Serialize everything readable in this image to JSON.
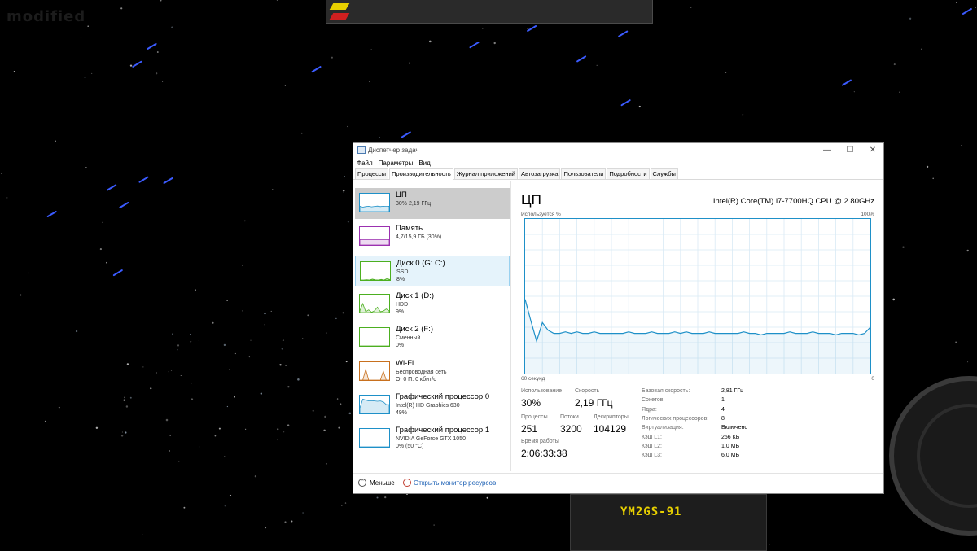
{
  "background": {
    "watermark": "modified",
    "ship_label": "YM2GS-91",
    "accent_colors": {
      "star": "#3b5bff",
      "hud_yellow": "#e8d000",
      "hud_red": "#d02020"
    }
  },
  "window": {
    "title": "Диспетчер задач",
    "controls": {
      "minimize": "—",
      "maximize": "☐",
      "close": "✕"
    },
    "menu": [
      "Файл",
      "Параметры",
      "Вид"
    ],
    "tabs": [
      "Процессы",
      "Производительность",
      "Журнал приложений",
      "Автозагрузка",
      "Пользователи",
      "Подробности",
      "Службы"
    ],
    "active_tab": "Производительность",
    "sidebar": [
      {
        "name": "ЦП",
        "sub1": "30%  2,19 ГГц",
        "sub2": "",
        "color": "#1e90c8",
        "state": "selected",
        "graph": [
          0.3,
          0.25,
          0.28,
          0.3,
          0.27,
          0.29,
          0.31,
          0.28,
          0.3,
          0.29,
          0.3
        ]
      },
      {
        "name": "Память",
        "sub1": "4,7/15,9 ГБ (30%)",
        "sub2": "",
        "color": "#9b30b0",
        "state": "",
        "graph": [
          0.3,
          0.3,
          0.3,
          0.3,
          0.3,
          0.3,
          0.3,
          0.3,
          0.3,
          0.3,
          0.3
        ]
      },
      {
        "name": "Диск 0 (G: C:)",
        "sub1": "SSD",
        "sub2": "8%",
        "color": "#4caf20",
        "state": "hover",
        "graph": [
          0,
          0,
          0.02,
          0,
          0.05,
          0.01,
          0,
          0.03,
          0,
          0.08,
          0.02
        ]
      },
      {
        "name": "Диск 1 (D:)",
        "sub1": "HDD",
        "sub2": "9%",
        "color": "#4caf20",
        "state": "",
        "graph": [
          0.1,
          0.5,
          0.05,
          0.15,
          0.02,
          0.1,
          0.3,
          0.05,
          0.08,
          0.2,
          0.09
        ]
      },
      {
        "name": "Диск 2 (F:)",
        "sub1": "Сменный",
        "sub2": "0%",
        "color": "#4caf20",
        "state": "",
        "graph": [
          0,
          0,
          0,
          0,
          0,
          0,
          0,
          0,
          0,
          0,
          0
        ]
      },
      {
        "name": "Wi-Fi",
        "sub1": "Беспроводная сеть",
        "sub2": "О: 0 П: 0 кбит/с",
        "color": "#c8701e",
        "state": "",
        "graph": [
          0,
          0,
          0.6,
          0,
          0,
          0,
          0,
          0,
          0.5,
          0,
          0
        ]
      },
      {
        "name": "Графический процессор 0",
        "sub1": "Intel(R) HD Graphics 630",
        "sub2": "49%",
        "color": "#1e90c8",
        "state": "",
        "graph": [
          0.3,
          0.8,
          0.75,
          0.7,
          0.72,
          0.7,
          0.68,
          0.7,
          0.65,
          0.5,
          0.49
        ]
      },
      {
        "name": "Графический процессор 1",
        "sub1": "NVIDIA GeForce GTX 1050",
        "sub2": "0% (50 °C)",
        "color": "#1e90c8",
        "state": "",
        "graph": [
          0,
          0,
          0,
          0,
          0,
          0,
          0,
          0,
          0,
          0,
          0
        ]
      }
    ],
    "main": {
      "title": "ЦП",
      "cpu_model": "Intel(R) Core(TM) i7-7700HQ CPU @ 2.80GHz",
      "y_label": "Используется %",
      "y_max_label": "100%",
      "x_left_label": "60 секунд",
      "x_right_label": "0",
      "chart_color": "#1e90c8",
      "stats": {
        "usage_label": "Использование",
        "usage": "30%",
        "speed_label": "Скорость",
        "speed": "2,19 ГГц",
        "procs_label": "Процессы",
        "procs": "251",
        "threads_label": "Потоки",
        "threads": "3200",
        "handles_label": "Дескрипторы",
        "handles": "104129",
        "uptime_label": "Время работы",
        "uptime": "2:06:33:38"
      },
      "details": [
        {
          "label": "Базовая скорость:",
          "value": "2,81 ГГц"
        },
        {
          "label": "Сокетов:",
          "value": "1"
        },
        {
          "label": "Ядра:",
          "value": "4"
        },
        {
          "label": "Логических процессоров:",
          "value": "8"
        },
        {
          "label": "Виртуализация:",
          "value": "Включено"
        },
        {
          "label": "Кэш L1:",
          "value": "256 КБ"
        },
        {
          "label": "Кэш L2:",
          "value": "1,0 МБ"
        },
        {
          "label": "Кэш L3:",
          "value": "6,0 МБ"
        }
      ]
    },
    "footer": {
      "less_label": "Меньше",
      "monitor_link": "Открыть монитор ресурсов"
    }
  },
  "chart_data": {
    "type": "area",
    "ylim": [
      0,
      100
    ],
    "x": [
      60,
      59,
      58,
      57,
      56,
      55,
      54,
      53,
      52,
      51,
      50,
      49,
      48,
      47,
      46,
      45,
      44,
      43,
      42,
      41,
      40,
      39,
      38,
      37,
      36,
      35,
      34,
      33,
      32,
      31,
      30,
      29,
      28,
      27,
      26,
      25,
      24,
      23,
      22,
      21,
      20,
      19,
      18,
      17,
      16,
      15,
      14,
      13,
      12,
      11,
      10,
      9,
      8,
      7,
      6,
      5,
      4,
      3,
      2,
      1,
      0
    ],
    "values": [
      48,
      34,
      21,
      33,
      28,
      26,
      26,
      27,
      26,
      27,
      26,
      26,
      27,
      26,
      26,
      26,
      26,
      26,
      27,
      26,
      26,
      26,
      27,
      26,
      26,
      26,
      27,
      26,
      27,
      26,
      26,
      26,
      27,
      26,
      26,
      26,
      26,
      26,
      27,
      26,
      26,
      25,
      26,
      26,
      26,
      26,
      27,
      26,
      26,
      26,
      27,
      26,
      26,
      26,
      25,
      26,
      26,
      26,
      25,
      26,
      30
    ]
  }
}
